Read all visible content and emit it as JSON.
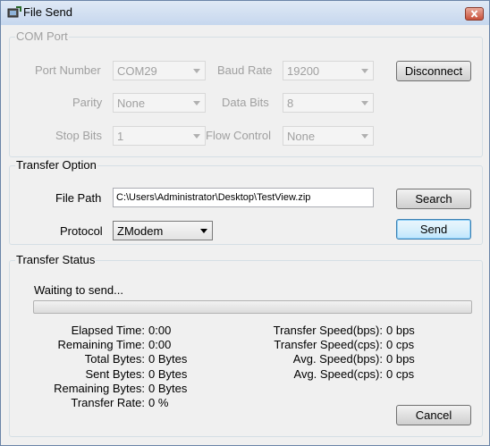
{
  "window": {
    "title": "File Send",
    "icons": {
      "app": "file-send-icon",
      "close": "close-icon"
    }
  },
  "com_port": {
    "legend": "COM Port",
    "port_number_label": "Port Number",
    "port_number_value": "COM29",
    "baud_rate_label": "Baud Rate",
    "baud_rate_value": "19200",
    "parity_label": "Parity",
    "parity_value": "None",
    "data_bits_label": "Data Bits",
    "data_bits_value": "8",
    "stop_bits_label": "Stop Bits",
    "stop_bits_value": "1",
    "flow_control_label": "Flow Control",
    "flow_control_value": "None",
    "disconnect_label": "Disconnect"
  },
  "transfer_option": {
    "legend": "Transfer Option",
    "file_path_label": "File Path",
    "file_path_value": "C:\\Users\\Administrator\\Desktop\\TestView.zip",
    "search_label": "Search",
    "protocol_label": "Protocol",
    "protocol_value": "ZModem",
    "send_label": "Send"
  },
  "transfer_status": {
    "legend": "Transfer Status",
    "status_text": "Waiting to send...",
    "progress_fraction": 0,
    "left_stats": [
      {
        "key": "Elapsed Time:",
        "value": "0:00"
      },
      {
        "key": "Remaining Time:",
        "value": "0:00"
      },
      {
        "key": "Total Bytes:",
        "value": "0 Bytes"
      },
      {
        "key": "Sent Bytes:",
        "value": "0 Bytes"
      },
      {
        "key": "Remaining Bytes:",
        "value": "0 Bytes"
      },
      {
        "key": "Transfer Rate:",
        "value": "0 %"
      }
    ],
    "right_stats": [
      {
        "key": "Transfer Speed(bps):",
        "value": "0 bps"
      },
      {
        "key": "Transfer Speed(cps):",
        "value": "0 cps"
      },
      {
        "key": "Avg. Speed(bps):",
        "value": "0 bps"
      },
      {
        "key": "Avg. Speed(cps):",
        "value": "0 cps"
      }
    ],
    "cancel_label": "Cancel"
  },
  "colors": {
    "accent": "#3c7fb1",
    "progress_fill": "#06b025",
    "disabled_text": "#a0a0a0"
  }
}
